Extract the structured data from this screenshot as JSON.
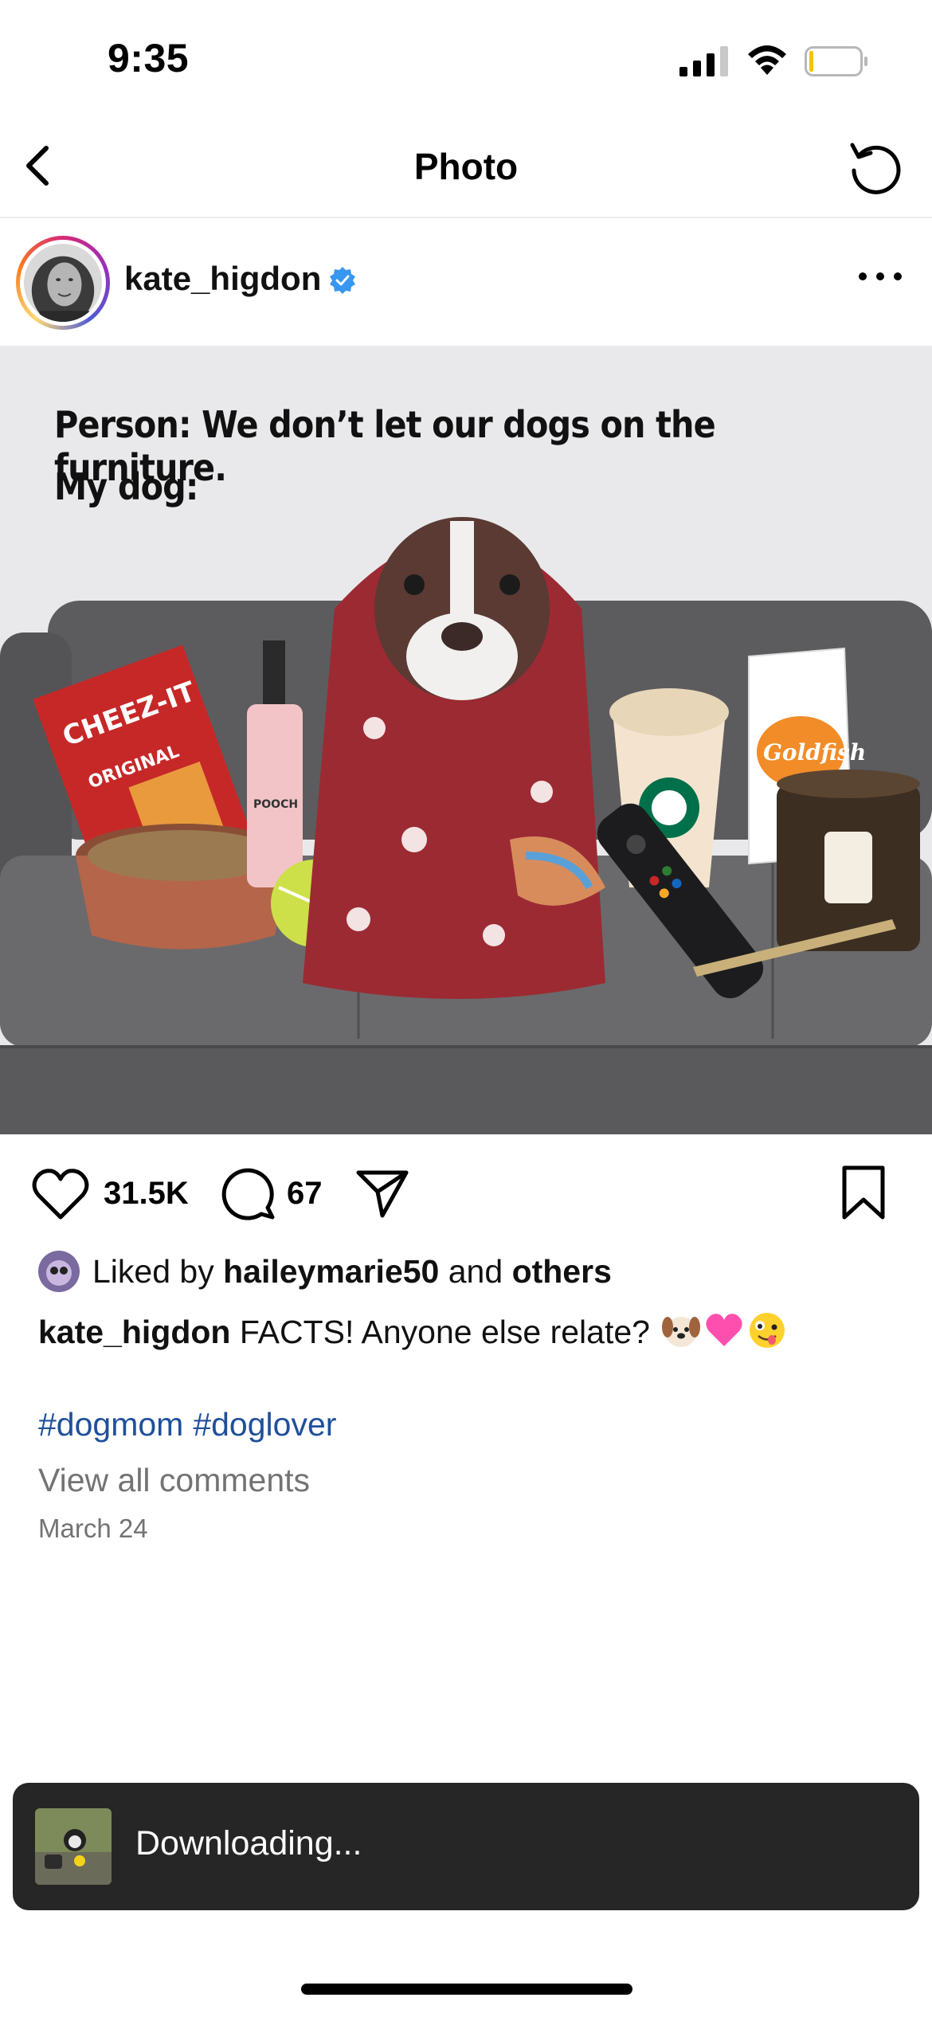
{
  "status_bar": {
    "time": "9:35",
    "signal_icon": "cellular-signal-icon",
    "wifi_icon": "wifi-icon",
    "battery_icon": "battery-low-icon"
  },
  "nav": {
    "title": "Photo",
    "back_icon": "chevron-left-icon",
    "refresh_icon": "refresh-icon"
  },
  "post": {
    "username": "kate_higdon",
    "verified": true,
    "more_icon": "more-horizontal-icon",
    "image": {
      "line1": "Person:  We don’t let our dogs on the furniture.",
      "line2": "My dog:",
      "brand_cheezit": "CHEEZ-IT",
      "brand_cheezit_sub": "ORIGINAL",
      "brand_goldfish": "Goldfish",
      "brand_pooch": "POOCH"
    },
    "likes": "31.5K",
    "comments": "67",
    "liked_by_prefix": "Liked by ",
    "liked_by_user": "haileymarie50",
    "liked_by_mid": " and ",
    "liked_by_others": "others",
    "caption_user": "kate_higdon",
    "caption_text": " FACTS!  Anyone else relate? ",
    "caption_emojis": [
      "dog-face-emoji",
      "pink-heart-emoji",
      "zany-face-emoji"
    ],
    "hashtags": [
      "#dogmom",
      "#doglover"
    ],
    "view_comments": "View all comments",
    "date": "March 24"
  },
  "toast": {
    "text": "Downloading..."
  },
  "colors": {
    "link": "#1f4f9a",
    "secondary": "#737373",
    "verified": "#3897f0",
    "toast_bg": "#262626"
  }
}
